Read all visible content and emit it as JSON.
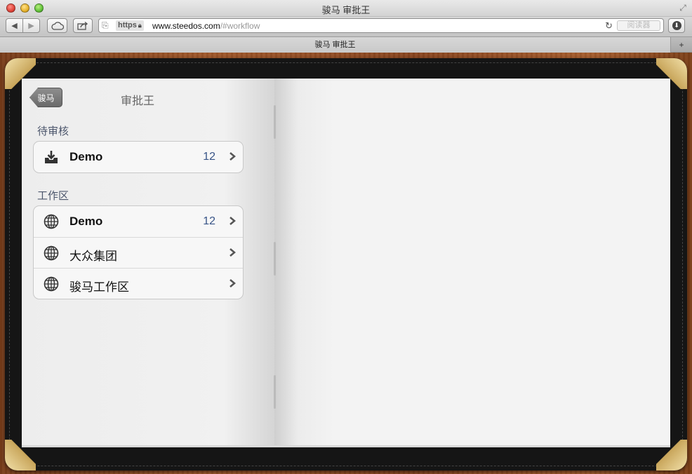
{
  "window": {
    "title": "骏马 审批王"
  },
  "toolbar": {
    "url_scheme": "https",
    "url_host": "www.steedos.com",
    "url_hash": "/#workflow",
    "reader_label": "阅读器"
  },
  "tab": {
    "title": "骏马 审批王"
  },
  "app": {
    "back_label": "骏马",
    "title": "审批王",
    "sections": [
      {
        "header": "待审核",
        "items": [
          {
            "label": "Demo",
            "count": "12",
            "icon": "download-tray-icon",
            "bold": true
          }
        ]
      },
      {
        "header": "工作区",
        "items": [
          {
            "label": "Demo",
            "count": "12",
            "icon": "globe-icon",
            "bold": true
          },
          {
            "label": "大众集团",
            "count": "",
            "icon": "globe-icon",
            "bold": false
          },
          {
            "label": "骏马工作区",
            "count": "",
            "icon": "globe-icon",
            "bold": false
          }
        ]
      }
    ]
  },
  "colors": {
    "section_header": "#4c566c",
    "count": "#385487",
    "leather": "#151515",
    "brass": "#c8a55a"
  }
}
